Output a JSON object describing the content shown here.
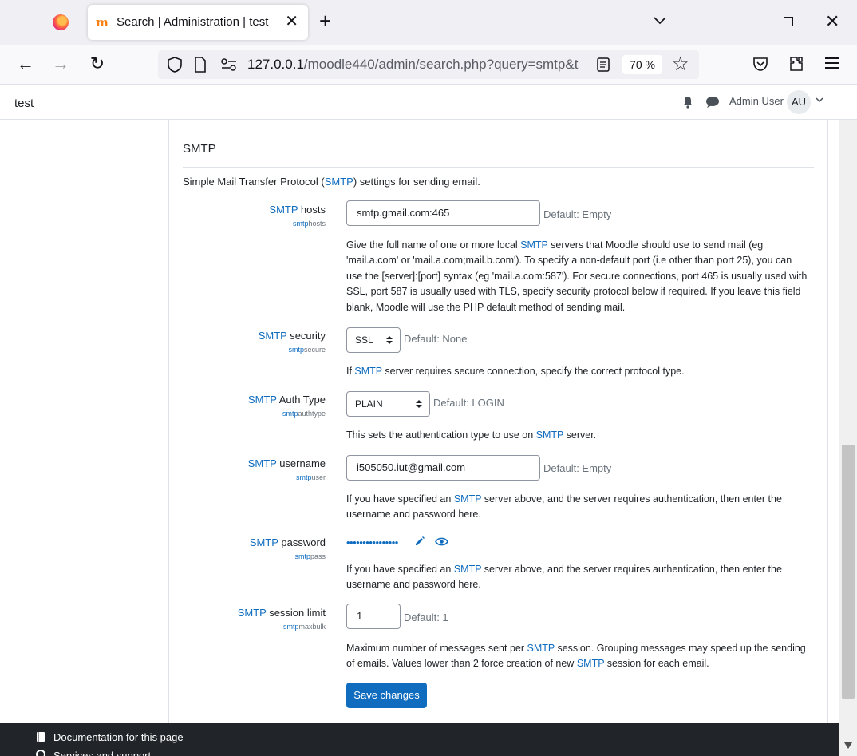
{
  "browser": {
    "tab_title": "Search | Administration | test",
    "url_host": "127.0.0.1",
    "url_path": "/moodle440/admin/search.php?query=smtp&t",
    "zoom": "70 %"
  },
  "header": {
    "site_name": "test",
    "user_name": "Admin User",
    "user_initials": "AU"
  },
  "section": {
    "title": "SMTP",
    "desc_before": "Simple Mail Transfer Protocol (",
    "desc_hl": "SMTP",
    "desc_after": ") settings for sending email."
  },
  "settings": {
    "hosts": {
      "label_hl": "SMTP",
      "label_rest": " hosts",
      "sub_hl": "smtp",
      "sub_rest": "hosts",
      "value": "smtp.gmail.com:465",
      "default": "Default: Empty",
      "help_1": "Give the full name of one or more local ",
      "help_hl": "SMTP",
      "help_2": " servers that Moodle should use to send mail (eg 'mail.a.com' or 'mail.a.com;mail.b.com'). To specify a non-default port (i.e other than port 25), you can use the [server]:[port] syntax (eg 'mail.a.com:587'). For secure connections, port 465 is usually used with SSL, port 587 is usually used with TLS, specify security protocol below if required. If you leave this field blank, Moodle will use the PHP default method of sending mail."
    },
    "security": {
      "label_hl": "SMTP",
      "label_rest": " security",
      "sub_hl": "smtp",
      "sub_rest": "secure",
      "value": "SSL",
      "default": "Default: None",
      "help_1": "If ",
      "help_hl": "SMTP",
      "help_2": " server requires secure connection, specify the correct protocol type."
    },
    "authtype": {
      "label_hl": "SMTP",
      "label_rest": " Auth Type",
      "sub_hl": "smtp",
      "sub_rest": "authtype",
      "value": "PLAIN",
      "default": "Default: LOGIN",
      "help_1": "This sets the authentication type to use on ",
      "help_hl": "SMTP",
      "help_2": " server."
    },
    "username": {
      "label_hl": "SMTP",
      "label_rest": " username",
      "sub_hl": "smtp",
      "sub_rest": "user",
      "value": "i505050.iut@gmail.com",
      "default": "Default: Empty",
      "help_1": "If you have specified an ",
      "help_hl": "SMTP",
      "help_2": " server above, and the server requires authentication, then enter the username and password here."
    },
    "password": {
      "label_hl": "SMTP",
      "label_rest": " password",
      "sub_hl": "smtp",
      "sub_rest": "pass",
      "masked": "••••••••••••••••",
      "help_1": "If you have specified an ",
      "help_hl": "SMTP",
      "help_2": " server above, and the server requires authentication, then enter the username and password here."
    },
    "maxbulk": {
      "label_hl": "SMTP",
      "label_rest": " session limit",
      "sub_hl": "smtp",
      "sub_rest": "maxbulk",
      "value": "1",
      "default": "Default: 1",
      "help_1": "Maximum number of messages sent per ",
      "help_hl": "SMTP",
      "help_2": " session. Grouping messages may speed up the sending of emails. Values lower than 2 force creation of new ",
      "help_hl2": "SMTP",
      "help_3": " session for each email."
    }
  },
  "save_label": "Save changes",
  "footer": {
    "documentation": "Documentation for this page",
    "support": "Services and support"
  },
  "colors": {
    "accent": "#0f6cbf",
    "footer_bg": "#212529"
  }
}
